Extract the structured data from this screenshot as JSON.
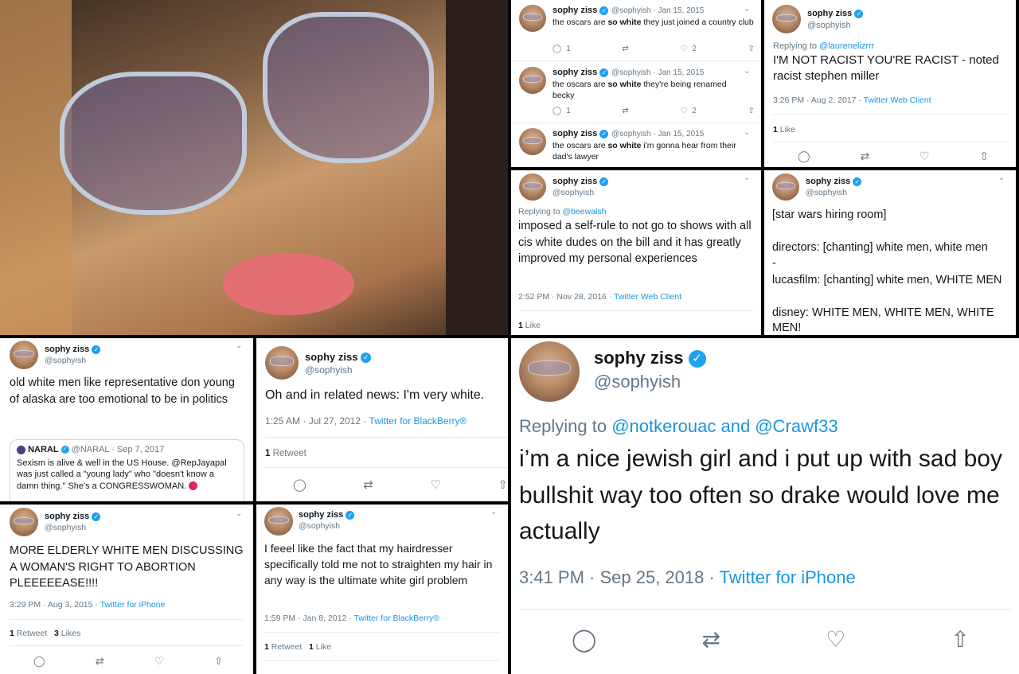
{
  "photo": {
    "alt": "profile selfie with sunglasses"
  },
  "colors": {
    "accent": "#1da1f2",
    "link": "#1b95e0",
    "muted": "#657786",
    "text": "#14171a"
  },
  "icons": {
    "reply": "reply-icon",
    "retweet": "retweet-icon",
    "like": "heart-icon",
    "share": "share-icon",
    "verified": "verified-badge-icon",
    "more": "chevron-down-icon"
  },
  "stack": {
    "tweets": [
      {
        "name": "sophy ziss",
        "handle_date": "@sophyish · Jan 15, 2015",
        "pre": "the oscars are ",
        "bold": "so white",
        "post": " they just joined a country club",
        "replies": "1",
        "likes": "2"
      },
      {
        "name": "sophy ziss",
        "handle_date": "@sophyish · Jan 15, 2015",
        "pre": "the oscars are ",
        "bold": "so white",
        "post": " they're being renamed becky",
        "replies": "1",
        "likes": "2"
      },
      {
        "name": "sophy ziss",
        "handle_date": "@sophyish · Jan 15, 2015",
        "pre": "the oscars are ",
        "bold": "so white",
        "post": " i'm gonna hear from their dad's lawyer"
      }
    ]
  },
  "t_miller": {
    "name": "sophy ziss",
    "handle": "@sophyish",
    "reply_prefix": "Replying to ",
    "reply_to": "@laurenelizrrr",
    "text": "I'M NOT RACIST YOU'RE RACIST - noted racist stephen miller",
    "time": "3:26 PM · Aug 2, 2017 · ",
    "source": "Twitter Web Client",
    "likes_count": "1",
    "likes_label": " Like"
  },
  "t_selfrule": {
    "name": "sophy ziss",
    "handle": "@sophyish",
    "reply_prefix": "Replying to ",
    "reply_to": "@beewalsh",
    "text": "imposed a self-rule to not go to shows with all cis white dudes on the bill and it has greatly improved my personal experiences",
    "time": "2:52 PM · Nov 28, 2016 · ",
    "source": "Twitter Web Client",
    "likes_count": "1",
    "likes_label": " Like"
  },
  "t_starwars": {
    "name": "sophy ziss",
    "handle": "@sophyish",
    "line1": "[star wars hiring room]",
    "line2": "directors: [chanting] white men, white men",
    "line3": "-",
    "line4": "lucasfilm: [chanting] white men, WHITE MEN",
    "line5": "disney: WHITE MEN, WHITE MEN, WHITE MEN!"
  },
  "t_oldmen": {
    "name": "sophy ziss",
    "handle": "@sophyish",
    "text": "old white men like representative don young of alaska are too emotional to be in politics",
    "quote": {
      "name": "NARAL",
      "handle_date": "@NARAL · Sep 7, 2017",
      "text": "Sexism is alive & well in the US House. @RepJayapal was just called a \"young lady\" who \"doesn't know a damn thing.\" She's a CONGRESSWOMAN."
    }
  },
  "t_white": {
    "name": "sophy ziss",
    "handle": "@sophyish",
    "text": "Oh and in related news: I'm very white.",
    "time": "1:25 AM · Jul 27, 2012 · ",
    "source": "Twitter for BlackBerry®",
    "rt_count": "1",
    "rt_label": " Retweet"
  },
  "t_drake": {
    "name": "sophy ziss",
    "handle": "@sophyish",
    "reply_prefix": "Replying to ",
    "reply_to": "@notkerouac and @Crawf33",
    "text": "i’m a nice jewish girl and i put up with sad boy bullshit way too often so drake would love me actually",
    "time": "3:41 PM · Sep 25, 2018 · ",
    "source": "Twitter for iPhone"
  },
  "t_abortion": {
    "name": "sophy ziss",
    "handle": "@sophyish",
    "text": "MORE ELDERLY WHITE MEN DISCUSSING A WOMAN'S RIGHT TO ABORTION PLEEEEEASE!!!!",
    "time": "3:29 PM · Aug 3, 2015 · ",
    "source": "Twitter for iPhone",
    "rt_count": "1",
    "rt_label": " Retweet",
    "likes_count": "3",
    "likes_label": " Likes"
  },
  "t_hair": {
    "name": "sophy ziss",
    "handle": "@sophyish",
    "text": "I feeel like the fact that my hairdresser specifically told me not to straighten my hair in any way is the ultimate white girl problem",
    "time": "1:59 PM · Jan 8, 2012 · ",
    "source": "Twitter for BlackBerry®",
    "rt_count": "1",
    "rt_label": " Retweet",
    "likes_count": "1",
    "likes_label": " Like"
  }
}
